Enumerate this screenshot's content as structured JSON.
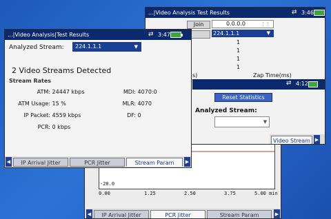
{
  "w3": {
    "y_tick_low": "-20.0",
    "x_ticks": [
      "0.00",
      "1.25",
      "2.50",
      "3.75",
      "5.00 min"
    ],
    "tabs": [
      "IP Arrival Jitter",
      "PCR Jitter",
      "Stream Param"
    ],
    "active_tab": 1,
    "trace_color": "#c0392b"
  },
  "w2": {
    "title": "...|Video Analysis Test Results",
    "clock": "3:46",
    "join_label": "Join",
    "leave_label": "",
    "address_field": "0.0.0.0",
    "selected_stream": "224.1.1.1",
    "list_numbers": [
      "1",
      "1",
      "1",
      "1"
    ],
    "col_left_header": "s)",
    "col_right_header": "Zap Time(ms)",
    "inner_clock": "4:12",
    "reset_label": "Reset Statistics",
    "analyzed_stream_label": "Analyzed Stream:",
    "analyzed_stream_value": "",
    "tab_visible": "Video Stream"
  },
  "w1": {
    "title": "...|Video Analysis|Test Results",
    "clock": "3:47",
    "analyzed_label": "Analyzed Stream:",
    "analyzed_value": "224.1.1.1",
    "detected": "2 Video Streams Detected",
    "section": "Stream Rates",
    "left_rows": [
      {
        "k": "ATM:",
        "v": "24447 kbps"
      },
      {
        "k": "ATM Usage:",
        "v": "15 %"
      },
      {
        "k": "IP Packet:",
        "v": "4559 kbps"
      },
      {
        "k": "PCR:",
        "v": "0 kbps"
      }
    ],
    "right_rows": [
      {
        "k": "MDI:",
        "v": "4070:0"
      },
      {
        "k": "MLR:",
        "v": "4070"
      },
      {
        "k": "DF:",
        "v": "0"
      }
    ],
    "tabs": [
      "IP Arrival Jitter",
      "PCR Jitter",
      "Stream Param"
    ],
    "active_tab": 2
  }
}
